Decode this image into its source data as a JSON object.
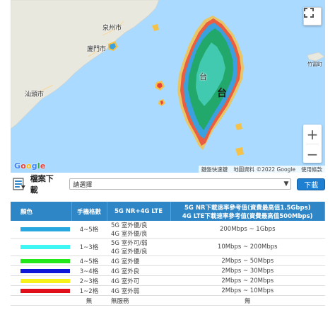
{
  "map": {
    "places": {
      "quanzhou": "泉州市",
      "xiamen": "廈門市",
      "shantou": "汕頭市",
      "taiwan_big": "台",
      "taiwan_side": "台",
      "east_label": "竹富町"
    },
    "google_logo": "Google",
    "attribution": {
      "shortcuts": "鍵盤快速鍵",
      "map_data": "地圖資料 ©2022 Google",
      "terms": "使用條款"
    },
    "fullscreen_icon": "fullscreen-icon",
    "zoom_in": "+",
    "zoom_out": "−",
    "colors": {
      "sea": "#aadaff",
      "land": "#e8e8e0",
      "coverage_blue": "#3aaee8",
      "coverage_green": "#1aa35a",
      "coverage_yellow": "#f2e23a",
      "coverage_red": "#e8343a"
    }
  },
  "download": {
    "icon": "file-download-icon",
    "title": "檔案下載",
    "select_value": "請選擇",
    "button_label": "下載"
  },
  "table": {
    "headers": {
      "color": "顏色",
      "bars": "手機格數",
      "tech": "5G NR+4G LTE",
      "speed_line1": "5G NR下載速率參考值(資費最高值1.5Gbps)",
      "speed_line2": "4G LTE下載速率參考值(資費最高值500Mbps)"
    },
    "rows": [
      {
        "color": "#29a8e0",
        "bars": "4~5格",
        "tech": [
          "5G 室外優/良",
          "4G 室外優/良"
        ],
        "speed": "200Mbps ~ 1Gbps"
      },
      {
        "color": "#3ff6f2",
        "bars": "1~3格",
        "tech": [
          "5G 室外可/弱",
          "4G 室外優/良"
        ],
        "speed": "10Mbps ~ 200Mbps"
      },
      {
        "color": "#22e81a",
        "bars": "4~5格",
        "tech": [
          "4G 室外優"
        ],
        "speed": "2Mbps ~ 50Mbps"
      },
      {
        "color": "#1018d8",
        "bars": "3~4格",
        "tech": [
          "4G 室外良"
        ],
        "speed": "2Mbps ~ 30Mbps"
      },
      {
        "color": "#f6f21a",
        "bars": "2~3格",
        "tech": [
          "4G 室外可"
        ],
        "speed": "2Mbps ~ 20Mbps"
      },
      {
        "color": "#e0101a",
        "bars": "1~2格",
        "tech": [
          "4G 室外弱"
        ],
        "speed": "2Mbps ~ 10Mbps"
      },
      {
        "color": "#ffffff",
        "bars": "無",
        "tech": [
          "無服務"
        ],
        "speed": "無"
      }
    ]
  }
}
